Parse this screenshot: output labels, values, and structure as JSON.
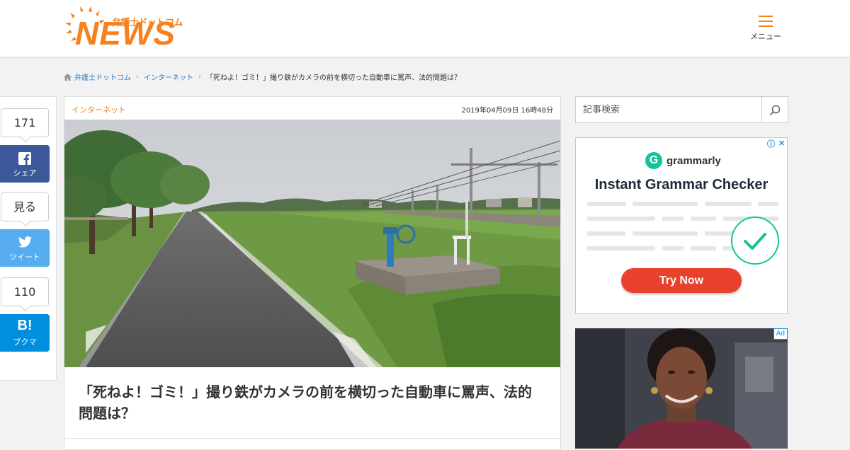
{
  "header": {
    "logo_top": "弁護士ドットコム",
    "logo_main": "NEWS",
    "menu_label": "メニュー"
  },
  "breadcrumb": {
    "home": "弁護士ドットコム",
    "category": "インターネット",
    "current": "「死ねよ！ゴミ！」撮り鉄がカメラの前を横切った自動車に罵声、法的問題は？"
  },
  "share": {
    "facebook_count": "171",
    "facebook_label": "シェア",
    "twitter_count": "見る",
    "twitter_label": "ツイート",
    "hatena_count": "110",
    "hatena_mark": "B!",
    "hatena_label": "ブクマ"
  },
  "article": {
    "category": "インターネット",
    "date": "2019年04月09日 16時48分",
    "title": "「死ねよ！ゴミ！」撮り鉄がカメラの前を横切った自動車に罵声、法的問題は？"
  },
  "sidebar": {
    "search_placeholder": "記事検索",
    "ad1": {
      "brand": "grammarly",
      "headline": "Instant Grammar Checker",
      "cta": "Try Now"
    },
    "ad2": {
      "badge": "Ad"
    }
  },
  "colors": {
    "brand_orange": "#f5821f",
    "link_blue": "#2a7ec4",
    "facebook": "#3b5998",
    "twitter": "#55acee",
    "hatena": "#008fde",
    "grammarly_green": "#15c39a",
    "cta_red": "#e8412c"
  },
  "icons": {
    "home": "home-icon",
    "facebook": "facebook-icon",
    "twitter": "twitter-bird-icon",
    "search": "search-icon",
    "menu": "hamburger-menu-icon",
    "ad_info": "info-icon",
    "ad_close": "close-icon"
  }
}
